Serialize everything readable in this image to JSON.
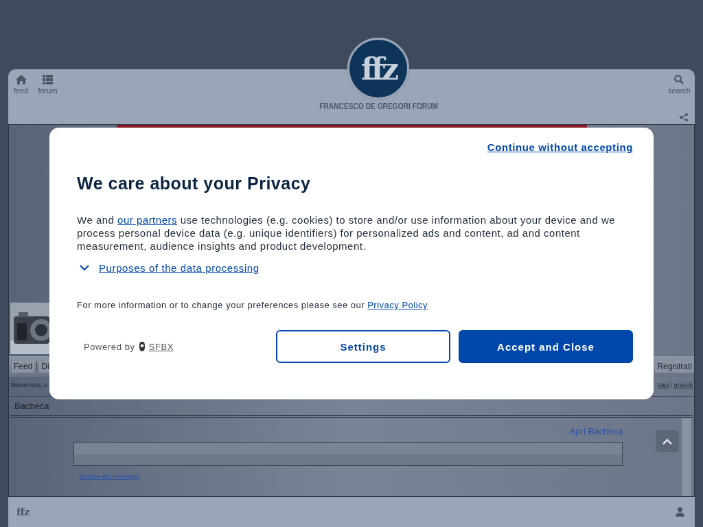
{
  "header": {
    "nav_left": [
      {
        "label": "feed"
      },
      {
        "label": "forum"
      }
    ],
    "nav_right": {
      "label": "search"
    },
    "logo": "ffz",
    "site_title": "FRANCESCO DE GREGORI FORUM"
  },
  "forum": {
    "nav_links": [
      "Feed",
      "Di"
    ],
    "right_link": "Registrati",
    "welcome": "Benvenuto, o",
    "top_links": [
      "ttaci",
      "unisciti"
    ],
    "section_title": "Bacheca",
    "open_link": "Apri Bacheca",
    "more_link": "Scarica altri messaggi"
  },
  "consent": {
    "continue_link": "Continue without accepting",
    "title": "We care about your Privacy",
    "body_before": "We and ",
    "body_link": "our partners",
    "body_after": " use technologies (e.g. cookies) to store and/or use information about your device and we process personal device data (e.g. unique identifiers) for personalized ads and content, ad and content measurement, audience insights and product development.",
    "purposes_link": "Purposes of the data processing",
    "info_text": "For more information or to change your preferences please see our ",
    "privacy_link": "Privacy Policy",
    "powered_by": "Powered by",
    "brand": "SFBX",
    "buttons": [
      {
        "label": "Settings",
        "kind": "outline"
      },
      {
        "label": "Accept and Close",
        "kind": "primary"
      }
    ]
  },
  "footer": {
    "logo": "ffz"
  }
}
